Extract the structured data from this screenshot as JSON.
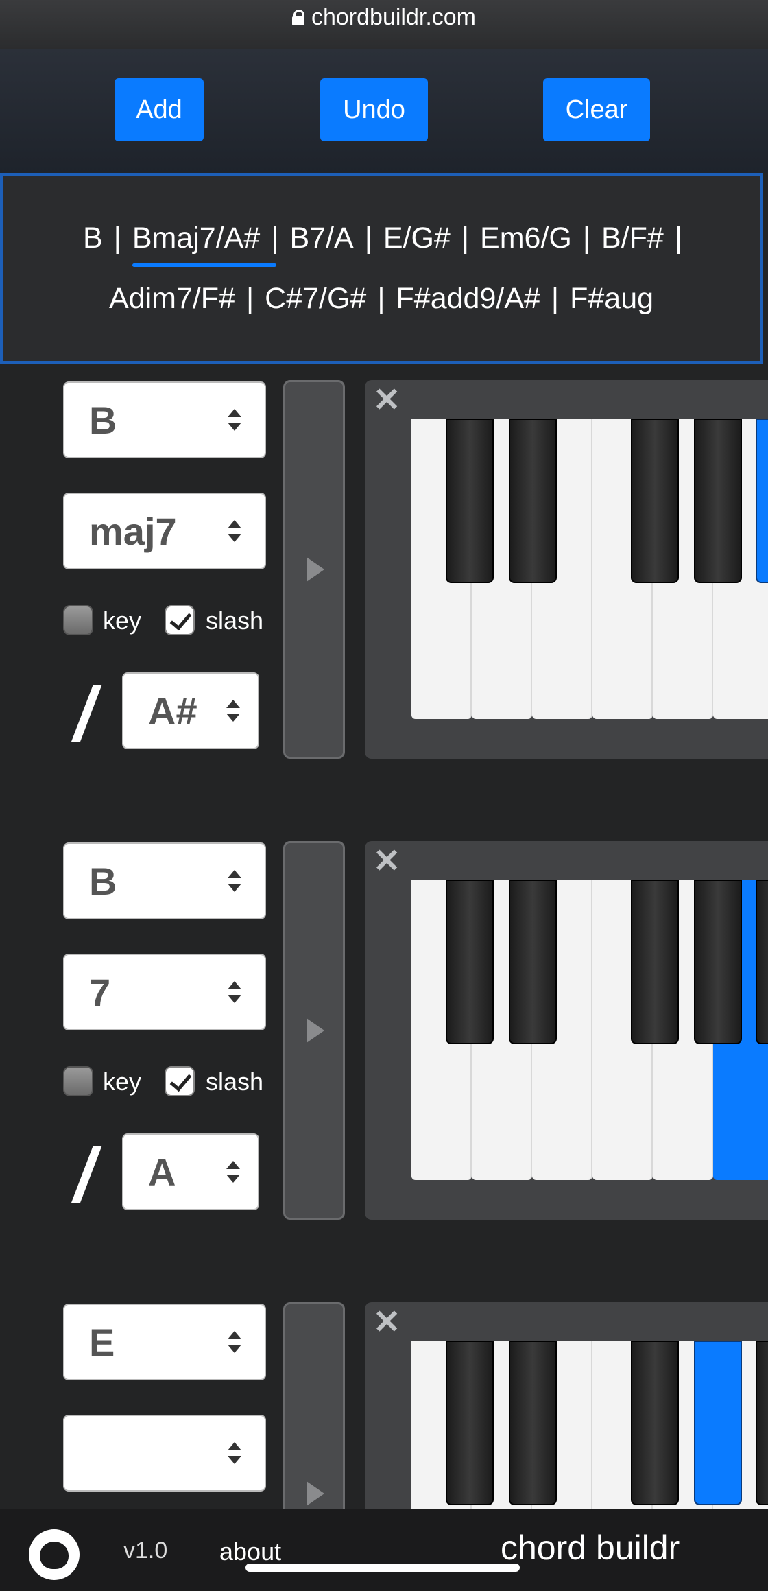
{
  "browser": {
    "url": "chordbuildr.com"
  },
  "toolbar": {
    "add_label": "Add",
    "undo_label": "Undo",
    "clear_label": "Clear"
  },
  "progression": {
    "separator": "|",
    "row1": [
      "B",
      "Bmaj7/A#",
      "B7/A",
      "E/G#",
      "Em6/G",
      "B/F#"
    ],
    "row2": [
      "Adim7/F#",
      "C#7/G#",
      "F#add9/A#",
      "F#aug"
    ],
    "selected": "Bmaj7/A#"
  },
  "chords": [
    {
      "root": "B",
      "quality": "maj7",
      "key_label": "key",
      "key_checked": false,
      "slash_label": "slash",
      "slash_checked": true,
      "slash_symbol": "/",
      "bass": "A#"
    },
    {
      "root": "B",
      "quality": "7",
      "key_label": "key",
      "key_checked": false,
      "slash_label": "slash",
      "slash_checked": true,
      "slash_symbol": "/",
      "bass": "A"
    },
    {
      "root": "E",
      "quality": ""
    }
  ],
  "footer": {
    "version": "v1.0",
    "about": "about",
    "brand": "chord buildr"
  },
  "colors": {
    "accent": "#0a7bff",
    "background": "#232425",
    "panel": "#424345"
  }
}
